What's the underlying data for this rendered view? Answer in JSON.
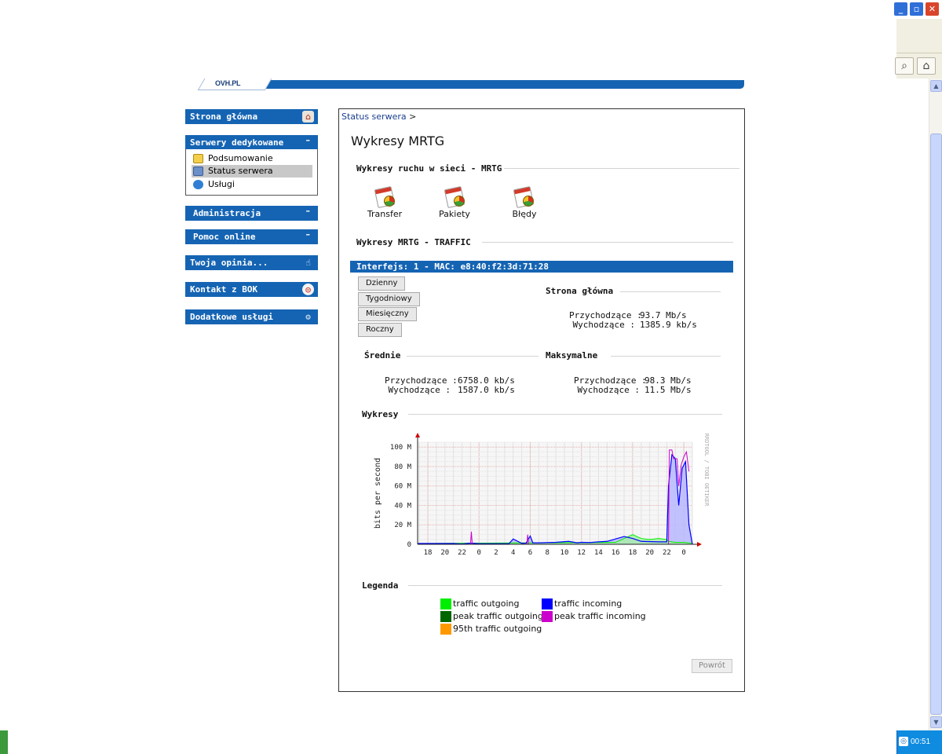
{
  "browser": {
    "window_controls": [
      "_",
      "▫",
      "✕"
    ],
    "toolbar_icons": [
      "search-icon",
      "home-icon"
    ],
    "clock": "00:51"
  },
  "banner": {
    "logo": "OVH.PL"
  },
  "sidebar": {
    "home": "Strona główna",
    "dedicated": {
      "title": "Serwery dedykowane",
      "items": [
        {
          "label": "Podsumowanie",
          "icon": "folder-icon"
        },
        {
          "label": "Status serwera",
          "icon": "chart-icon",
          "active": true
        },
        {
          "label": "Usługi",
          "icon": "services-icon"
        }
      ]
    },
    "admin": "Administracja",
    "help": "Pomoc online",
    "opinion": "Twoja opinia...",
    "contact": "Kontakt z BOK",
    "extra": "Dodatkowe usługi"
  },
  "main": {
    "breadcrumb": "Status serwera",
    "breadcrumb_sep": ">",
    "title": "Wykresy MRTG",
    "network_section": "Wykresy ruchu w sieci - MRTG",
    "icons": [
      {
        "label": "Transfer"
      },
      {
        "label": "Pakiety"
      },
      {
        "label": "Błędy"
      }
    ],
    "traffic_section": "Wykresy MRTG - TRAFFIC",
    "interface": "Interfejs: 1 - MAC: e8:40:f2:3d:71:28",
    "periods": [
      "Dzienny",
      "Tygodniowy",
      "Miesięczny",
      "Roczny"
    ],
    "home_stats": {
      "title": "Strona główna",
      "in_label": "Przychodzące :",
      "in_value": "93.7 Mb/s",
      "out_label": "Wychodzące :",
      "out_value": "1385.9 kb/s"
    },
    "avg_stats": {
      "title": "Średnie",
      "in_label": "Przychodzące :",
      "in_value": "6758.0 kb/s",
      "out_label": "Wychodzące :",
      "out_value": "1587.0 kb/s"
    },
    "max_stats": {
      "title": "Maksymalne",
      "in_label": "Przychodzące :",
      "in_value": "98.3 Mb/s",
      "out_label": "Wychodzące :",
      "out_value": "11.5 Mb/s"
    },
    "charts_section": "Wykresy",
    "legend_section": "Legenda",
    "back_button": "Powrót"
  },
  "chart_data": {
    "type": "area",
    "title": "",
    "ylabel": "bits per second",
    "xlabel": "",
    "watermark": "RRDTOOL / TOBI OETIKER",
    "ylim": [
      0,
      105
    ],
    "y_unit": "M",
    "y_ticks": [
      0,
      20,
      40,
      60,
      80,
      100
    ],
    "y_tick_labels": [
      "0",
      "20 M",
      "40 M",
      "60 M",
      "80 M",
      "100 M"
    ],
    "x_tick_labels": [
      "18",
      "20",
      "22",
      "0",
      "2",
      "4",
      "6",
      "8",
      "10",
      "12",
      "14",
      "16",
      "18",
      "20",
      "22",
      "0"
    ],
    "x_hours": [
      0,
      2,
      4,
      6,
      8,
      10,
      12,
      14,
      16,
      18,
      20,
      22,
      24,
      26,
      28,
      30
    ],
    "xlim": [
      -1.2,
      31
    ],
    "grid": true,
    "colors": {
      "traffic_outgoing": "#00ee00",
      "peak_traffic_outgoing": "#006600",
      "traffic_incoming": "#0000ff",
      "peak_traffic_incoming": "#cc00cc",
      "percentile_95_outgoing": "#ff9900"
    },
    "series": [
      {
        "name": "traffic incoming",
        "x": [
          -1.2,
          3,
          4,
          5,
          6,
          9.5,
          10,
          11,
          11.5,
          12,
          12.3,
          13,
          15,
          16.5,
          17.5,
          18,
          19,
          20,
          21,
          22,
          23,
          24,
          25,
          27,
          27.5,
          28,
          28.2,
          28.6,
          29,
          29.4,
          29.8,
          30.2,
          30.6,
          31
        ],
        "values": [
          0.8,
          0.8,
          0.3,
          1.2,
          0.6,
          0.6,
          5.5,
          1,
          1.2,
          8.5,
          1.5,
          1.5,
          2,
          3,
          1.5,
          2,
          1.8,
          2.5,
          3,
          5.5,
          8,
          6,
          3,
          2.5,
          2.5,
          2.5,
          60,
          92,
          88,
          40,
          78,
          85,
          20,
          0
        ]
      },
      {
        "name": "peak traffic incoming",
        "x": [
          5.0,
          5.1,
          5.2,
          11.6,
          11.7,
          11.8,
          28.2,
          28.3,
          28.6,
          28.8,
          29.2,
          29.4,
          29.7,
          30.0,
          30.3,
          30.6
        ],
        "values": [
          0,
          13,
          0,
          0,
          10,
          0,
          0,
          97,
          97,
          88,
          88,
          60,
          82,
          90,
          95,
          75
        ]
      },
      {
        "name": "traffic outgoing",
        "x": [
          -1.2,
          22,
          24,
          25,
          26,
          27,
          28,
          28.2,
          29,
          30,
          31
        ],
        "values": [
          0.8,
          2,
          10,
          6,
          5,
          6,
          5,
          3,
          2,
          2,
          1
        ]
      },
      {
        "name": "peak traffic outgoing",
        "x": [],
        "values": []
      },
      {
        "name": "95th traffic outgoing",
        "x": [],
        "values": []
      }
    ]
  },
  "legend": [
    {
      "label": "traffic outgoing",
      "color": "#00ee00"
    },
    {
      "label": "traffic incoming",
      "color": "#0000ff"
    },
    {
      "label": "peak traffic outgoing",
      "color": "#006600"
    },
    {
      "label": "peak traffic incoming",
      "color": "#cc00cc"
    },
    {
      "label": "95th traffic outgoing",
      "color": "#ff9900"
    }
  ]
}
